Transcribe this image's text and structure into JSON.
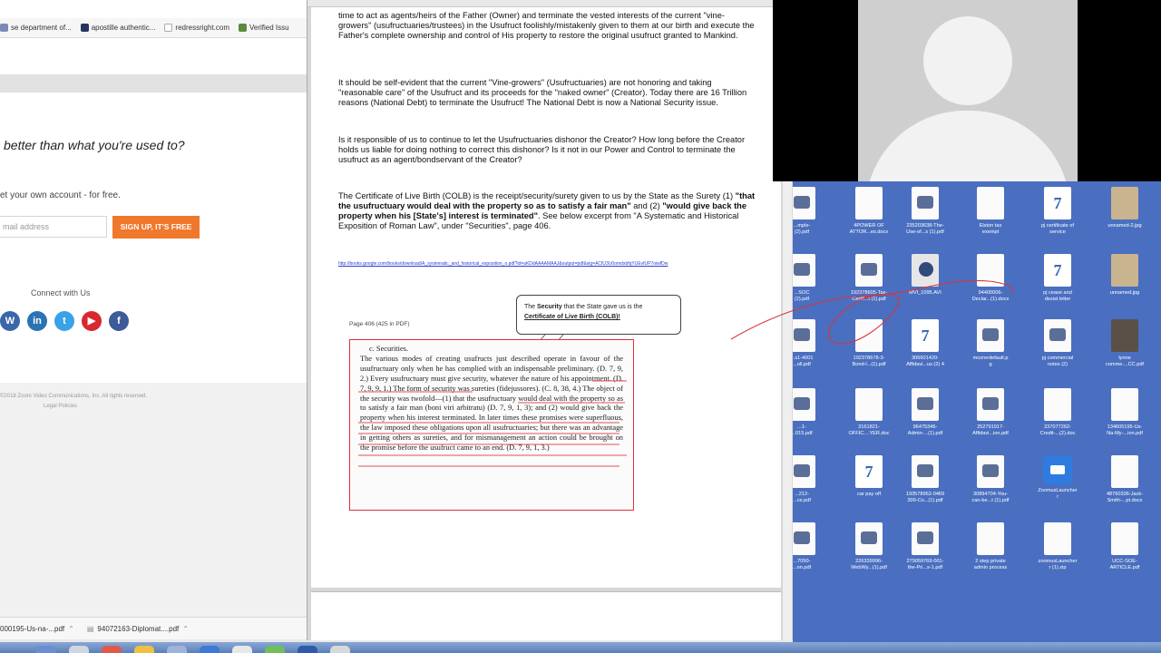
{
  "browser": {
    "bookmarks": [
      {
        "label": "se department of...",
        "color": "#7a8ab8",
        "icon": "bookmark-favicon"
      },
      {
        "label": "apostille authentic...",
        "color": "#26355e",
        "icon": "bookmark-favicon"
      },
      {
        "label": "redressright.com",
        "color": "#ffffff",
        "icon": "document-icon"
      },
      {
        "label": "Verified Issu",
        "color": "#5b8a3c",
        "icon": "bookmark-favicon"
      }
    ],
    "headline": "better than what you're used to?",
    "subline": "et your own account - for free.",
    "email_placeholder": "mail address",
    "signup_label": "SIGN UP, IT'S FREE",
    "connect_label": "Connect with Us",
    "socials": [
      {
        "label": "W",
        "color": "#3b66a8",
        "icon": "wordpress-icon"
      },
      {
        "label": "in",
        "color": "#2c73b2",
        "icon": "linkedin-icon"
      },
      {
        "label": "t",
        "color": "#3aa2e6",
        "icon": "twitter-icon"
      },
      {
        "label": "▶",
        "color": "#d9272e",
        "icon": "youtube-icon"
      },
      {
        "label": "f",
        "color": "#3d5b98",
        "icon": "facebook-icon"
      }
    ],
    "copyright": "©2018 Zoom Video Communications, Inc. All rights reserved.",
    "legal": "Legal Policies",
    "downloads": [
      "000195-Us-na-...pdf",
      "94072163-Diplomat....pdf"
    ]
  },
  "pdf": {
    "para1": "time to act as agents/heirs of the Father (Owner) and terminate the vested interests of the current \"vine-growers\" (usufructuaries/trustees) in the Usufruct foolishly/mistakenly given to them at our birth and execute the Father's complete ownership and control of His property to restore the original usufruct granted to Mankind.",
    "para2": "It should be self-evident that the current \"Vine-growers\" (Usufructuaries) are not honoring and taking \"reasonable care\" of the Usufruct and its proceeds for the \"naked owner\" (Creator). Today there are 16 Trillion reasons (National Debt) to terminate the Usufruct! The National Debt is now a National Security issue.",
    "para3": "Is it responsible of us to continue to let the Usufructuaries dishonor the Creator? How long before the Creator holds us liable for doing nothing to correct this dishonor? Is it not in our Power and Control to terminate the usufruct as an agent/bondservant of the Creator?",
    "para4_a": "The Certificate of Live Birth (COLB) is the receipt/security/surety given to us by the State as the Surety (1) ",
    "para4_b": "\"that the usufructuary would deal with the property so as to satisfy a fair man\"",
    "para4_c": " and (2) ",
    "para4_d": "\"would give back the property when his [State's] interest is terminated\"",
    "para4_e": ". See below excerpt from \"A Systematic and Historical Exposition of Roman Law\", under \"Securities\", page 406.",
    "link": "http://books.google.com/books/download/A_systematic_and_historical_exposition_o.pdf?id=aKDdAAAAMAAJ&output=pdf&sig=ACfU3U0omdxbfqYUEvfUP7oiwfDw",
    "page_ref": "Page 406 (425 in PDF)",
    "callout_a": "The ",
    "callout_b": "Security",
    "callout_c": " that the State gave us is the ",
    "callout_d": "Certificate of Live Birth (COLB)!",
    "excerpt_heading": "c. Securities.",
    "excerpt_body": "The various modes of creating usufructs just described operate in favour of the usufructuary only when he has complied with an indispensable preliminary. (D. 7, 9, 2.) Every usufructuary must give security, whatever the nature of his appointment. (D. 7, 9, 9, 1.) The form of security was sureties (fidejussores). (C. 8, 38, 4.) The object of the security was twofold—(1) that the usufructuary would deal with the property so as to satisfy a fair man (boni viri arbitratu) (D. 7, 9, 1, 3); and (2) would give back the property when his interest terminated. In later times these promises were superfluous, the law imposed these obligations upon all usufructuaries; but there was an advantage in getting others as sureties, and for mismanagement an action could be brought on the promise before the usufruct came to an end. (D. 7, 9, 1, 3.)"
  },
  "desktop": {
    "icons": [
      {
        "label": "...mple-\n(2).pdf",
        "type": "pdfico",
        "icon": "pdf-file-icon"
      },
      {
        "label": "4POWER OF\nATTOR...es.docx",
        "type": "doc",
        "icon": "docx-file-icon"
      },
      {
        "label": "235203638-The-\nUse-of...s (1).pdf",
        "type": "pdfico",
        "icon": "pdf-file-icon"
      },
      {
        "label": "Elston tax\nexempt",
        "type": "doc",
        "icon": "document-icon"
      },
      {
        "label": "pj certificate of\nservice",
        "type": "w7",
        "icon": "word-file-icon"
      },
      {
        "label": "unnamed-2.jpg",
        "type": "img",
        "icon": "image-file-icon"
      },
      {
        "label": "...SOC\n(2).pdf",
        "type": "pdfico",
        "icon": "pdf-file-icon"
      },
      {
        "label": "192378605-Tax-\nCertif...t (1).pdf",
        "type": "pdfico",
        "icon": "pdf-file-icon"
      },
      {
        "label": "MVI_1095.AVI",
        "type": "mov",
        "icon": "video-file-icon"
      },
      {
        "label": "94400006-\nDeclar...(1).docx",
        "type": "doc",
        "icon": "docx-file-icon"
      },
      {
        "label": "pj cease and\ndesist letter",
        "type": "w7",
        "icon": "word-file-icon"
      },
      {
        "label": "unnamed.jpg",
        "type": "img",
        "icon": "image-file-icon"
      },
      {
        "label": "...s1-4001\n...oll.pdf",
        "type": "pdfico",
        "icon": "pdf-file-icon"
      },
      {
        "label": "192378678-3-\nBond-l...(1).pdf",
        "type": "doc",
        "icon": "pdf-file-icon"
      },
      {
        "label": "306601420-\nAffidavi...us (2) 4",
        "type": "w7",
        "icon": "word-file-icon"
      },
      {
        "label": "mozrerdefault.p\ng",
        "type": "pdfico",
        "icon": "image-file-icon"
      },
      {
        "label": "pj commercial\nnotes (2)",
        "type": "pdfico",
        "icon": "document-icon"
      },
      {
        "label": "lynne\ncomme....CC.pdf",
        "type": "dark",
        "icon": "pdf-file-icon"
      },
      {
        "label": "...1-\n...015.pdf",
        "type": "pdfico",
        "icon": "pdf-file-icon"
      },
      {
        "label": "3161821-\nOFFIC....YER.doc",
        "type": "doc",
        "icon": "docx-file-icon"
      },
      {
        "label": "96475346-\nAdmin-...(1).pdf",
        "type": "pdfico",
        "icon": "pdf-file-icon"
      },
      {
        "label": "252791917-\nAffidavi...ion.pdf",
        "type": "pdfico",
        "icon": "pdf-file-icon"
      },
      {
        "label": "237077262-\nCredit-...(2).doc",
        "type": "doc",
        "icon": "docx-file-icon"
      },
      {
        "label": "134605195-Us-\nNa-My-...ion.pdf",
        "type": "doc",
        "icon": "pdf-file-icon"
      },
      {
        "label": "...212-\n...ce.pdf",
        "type": "pdfico",
        "icon": "pdf-file-icon"
      },
      {
        "label": "car pay off",
        "type": "w7",
        "icon": "word-file-icon"
      },
      {
        "label": "193578962-0469\n309-Co...(1).pdf",
        "type": "pdfico",
        "icon": "pdf-file-icon"
      },
      {
        "label": "30894704-You-\ncan-be...t (1).pdf",
        "type": "pdfico",
        "icon": "pdf-file-icon"
      },
      {
        "label": "ZoomusLauncher\nr",
        "type": "zoom",
        "icon": "zoom-launcher-icon"
      },
      {
        "label": "48760336-Jack-\nSmith-...pt.docx",
        "type": "doc",
        "icon": "docx-file-icon"
      },
      {
        "label": "...7050-\n...on.pdf",
        "type": "pdfico",
        "icon": "pdf-file-icon"
      },
      {
        "label": "226339996-\nWebWy...(1).pdf",
        "type": "pdfico",
        "icon": "pdf-file-icon"
      },
      {
        "label": "279059769-001-\nthe-Pri...s-1.pdf",
        "type": "pdfico",
        "icon": "pdf-file-icon"
      },
      {
        "label": "2 step private\nadmin process",
        "type": "doc",
        "icon": "document-icon"
      },
      {
        "label": "zoomusLauncher\nr (1).zip",
        "type": "doc",
        "icon": "zip-file-icon"
      },
      {
        "label": "UCC-SOE-\nARTICLE.pdf",
        "type": "doc",
        "icon": "pdf-file-icon"
      }
    ]
  },
  "dock": {
    "items": [
      {
        "color": "#6a8fd0",
        "icon": "finder-icon"
      },
      {
        "color": "#d0d6e2",
        "icon": "launchpad-icon"
      },
      {
        "color": "#e05a4b",
        "icon": "app-icon"
      },
      {
        "color": "#f0c040",
        "icon": "app-icon"
      },
      {
        "color": "#9fb4d8",
        "icon": "app-icon"
      },
      {
        "color": "#3d7ad6",
        "icon": "app-icon"
      },
      {
        "color": "#e8e8e8",
        "icon": "app-icon"
      },
      {
        "color": "#6fbf5a",
        "icon": "app-icon"
      },
      {
        "color": "#2f5aa8",
        "icon": "app-icon"
      },
      {
        "color": "#d8d8d8",
        "icon": "app-icon"
      }
    ]
  }
}
